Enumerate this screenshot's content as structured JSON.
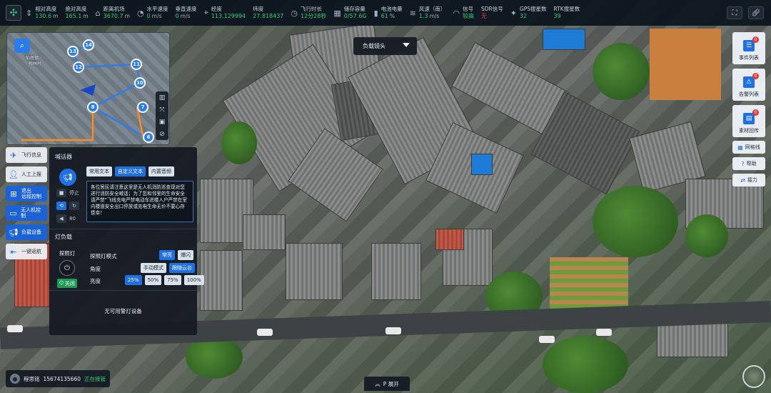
{
  "telemetry": [
    {
      "icon": "altitude-icon",
      "pair": [
        {
          "label": "相对高度",
          "value": "130.6",
          "unit": "m"
        },
        {
          "label": "绝对高度",
          "value": "165.1",
          "unit": "m"
        }
      ]
    },
    {
      "icon": "distance-icon",
      "pair": [
        {
          "label": "距离机场",
          "value": "3670.7",
          "unit": "m"
        }
      ]
    },
    {
      "icon": "speed-icon",
      "pair": [
        {
          "label": "水平速度",
          "value": "0",
          "unit": "m/s"
        },
        {
          "label": "垂直速度",
          "value": "0",
          "unit": "m/s"
        }
      ]
    },
    {
      "icon": "location-icon",
      "pair": [
        {
          "label": "经度",
          "value": "113.129994",
          "unit": ""
        },
        {
          "label": "纬度",
          "value": "27.818437",
          "unit": ""
        }
      ]
    },
    {
      "icon": "flight-time-icon",
      "pair": [
        {
          "label": "飞行时长",
          "value": "12分28秒",
          "unit": ""
        }
      ]
    },
    {
      "icon": "storage-icon",
      "pair": [
        {
          "label": "储存容量",
          "value": "0/57.6G",
          "unit": ""
        }
      ]
    },
    {
      "icon": "battery-icon",
      "pair": [
        {
          "label": "电池电量",
          "value": "61",
          "unit": "%"
        }
      ]
    },
    {
      "icon": "wind-icon",
      "pair": [
        {
          "label": "风速（南）",
          "value": "1.3",
          "unit": "m/s"
        }
      ]
    },
    {
      "icon": "signal-icon",
      "pair": [
        {
          "label": "信号",
          "value": "较高",
          "unit": ""
        },
        {
          "label": "SDR信号",
          "value": "无",
          "unit": ""
        }
      ]
    },
    {
      "icon": "satellite-icon",
      "pair": [
        {
          "label": "GPS搜星数",
          "value": "32",
          "unit": ""
        },
        {
          "label": "RTK搜星数",
          "value": "39",
          "unit": ""
        }
      ]
    }
  ],
  "sdr_no_color": "#e53935",
  "accent": "#1e70e3",
  "status_green": "#29d37a",
  "minimap": {
    "labels": [
      "仙居镇",
      "梅林村"
    ],
    "waypoints": [
      "14",
      "13",
      "12",
      "11",
      "10",
      "8",
      "7",
      "6"
    ]
  },
  "leftnav": [
    {
      "icon": "drone-icon",
      "label": "飞行信息",
      "active": false
    },
    {
      "icon": "person-icon",
      "label": "人工上报",
      "active": false
    },
    {
      "icon": "remote-control-icon",
      "label": "退出\n远程控制",
      "active": true
    },
    {
      "icon": "drone-control-icon",
      "label": "无人机控制",
      "active": true
    },
    {
      "icon": "payload-icon",
      "label": "负载设备",
      "active": true
    },
    {
      "icon": "return-icon",
      "label": "一键返航",
      "active": false
    }
  ],
  "speaker": {
    "title": "喊话器",
    "stop_label": "停止",
    "volume": "80",
    "modes": [
      "常用文本",
      "自定义文本",
      "内置音频"
    ],
    "text": "各位居民请注意这里是无人机消防巡查现对您进行消防安全喊话；为了您和邻里的生命安全请严禁\"飞线充电严禁电动车进楼入户严禁在室内楼道安全出口停放或充电生命无价不要心存侥幸！"
  },
  "lamp": {
    "title": "灯负载",
    "lamp_label": "探照灯",
    "off_label": "关闭",
    "mode_label": "探照灯模式",
    "modes": [
      "常亮",
      "爆闪"
    ],
    "angle_label": "角度",
    "angle_modes": [
      "手动模式",
      "跟随云台"
    ],
    "brightness_label": "亮度",
    "brightness": [
      "25%",
      "50%",
      "75%",
      "100%"
    ],
    "no_device": "无可用警灯设备"
  },
  "camera_select": "负载镜头",
  "right_panel": [
    {
      "icon": "event-list-icon",
      "label": "事件列表",
      "badge": "0"
    },
    {
      "icon": "alarm-list-icon",
      "label": "告警列表",
      "badge": "0"
    },
    {
      "icon": "media-return-icon",
      "label": "素材回传",
      "badge": "0"
    }
  ],
  "right_small": [
    {
      "icon": "grid-icon",
      "label": "网格线"
    },
    {
      "icon": "help-icon",
      "label": "帮助"
    },
    {
      "icon": "relay-icon",
      "label": "接力"
    }
  ],
  "contact": {
    "name": "程思铭",
    "phone": "15674135660",
    "status": "正在接管"
  },
  "expand_label": "P 展开"
}
